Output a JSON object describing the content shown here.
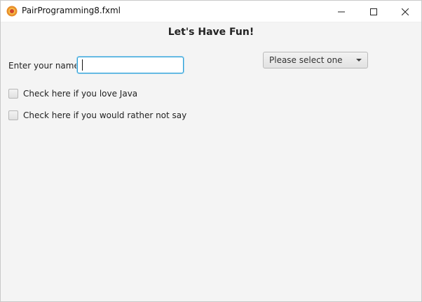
{
  "window": {
    "title": "PairProgramming8.fxml",
    "app_icon": "java-app-icon",
    "controls": {
      "minimize_icon": "minimize-icon",
      "maximize_icon": "maximize-icon",
      "close_icon": "close-icon"
    }
  },
  "form": {
    "heading": "Let's Have Fun!",
    "name_label": "Enter your name:",
    "name_value": "",
    "name_placeholder": "",
    "dropdown": {
      "selected": "Please select one"
    },
    "checkboxes": [
      {
        "label": "Check here if you love Java",
        "checked": false
      },
      {
        "label": "Check here if you would rather not say",
        "checked": false
      }
    ]
  },
  "colors": {
    "focus_border": "#2a9fd6",
    "background": "#f4f4f4"
  }
}
